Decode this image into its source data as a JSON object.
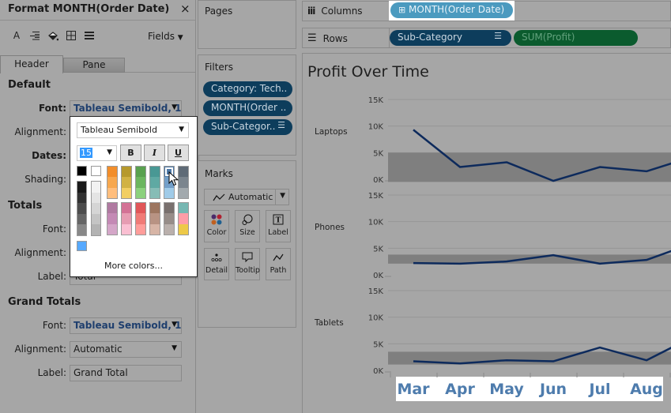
{
  "format_pane": {
    "title": "Format MONTH(Order Date)",
    "close_icon": "×",
    "toolbar_icons": [
      "font-icon",
      "alignment-icon",
      "shading-icon",
      "borders-icon",
      "lines-icon"
    ],
    "fields_label": "Fields",
    "tabs": [
      {
        "label": "Header",
        "active": true
      },
      {
        "label": "Pane",
        "active": false
      }
    ],
    "default_section": {
      "title": "Default",
      "font_label": "Font:",
      "font_value": "Tableau Semibold, 1..",
      "alignment_label": "Alignment:",
      "dates_label": "Dates:",
      "shading_label": "Shading:"
    },
    "totals_section": {
      "title": "Totals",
      "font_label": "Font:",
      "alignment_label": "Alignment:",
      "label_label": "Label:",
      "label_value": "Total"
    },
    "grand_totals_section": {
      "title": "Grand Totals",
      "font_label": "Font:",
      "font_value": "Tableau Semibold, 1..",
      "alignment_label": "Alignment:",
      "alignment_value": "Automatic",
      "label_label": "Label:",
      "label_value": "Grand Total"
    }
  },
  "font_popup": {
    "font_family": "Tableau Semibold",
    "font_size": "15",
    "bold_label": "B",
    "italic_label": "I",
    "underline_label": "U",
    "selected_color": "#4e79a7",
    "black": "#000000",
    "white": "#ffffff",
    "recent_color": "#56a9ff",
    "gray_ramp_dark": [
      "#1a1a1a",
      "#333333",
      "#4d4d4d",
      "#666666",
      "#888888"
    ],
    "gray_ramp_light": [
      "#f2f2f2",
      "#e4e4e4",
      "#d5d5d5",
      "#c4c4c4",
      "#b3b3b3"
    ],
    "palette_row1": [
      [
        "#f28e2b",
        "#f7a84f",
        "#ffbe7d"
      ],
      [
        "#b6992d",
        "#d1b244",
        "#f1ce63"
      ],
      [
        "#59a14f",
        "#6cb65f",
        "#8cd17d"
      ],
      [
        "#499894",
        "#5fa9a3",
        "#86bcb6"
      ],
      [
        "#4e79a7",
        "#739fc9",
        "#a0cbe8"
      ],
      [
        "#5f6b77",
        "#7b858e",
        "#a2a9ad"
      ]
    ],
    "palette_row2": [
      [
        "#b07aa1",
        "#c48ab5",
        "#d4a6c8"
      ],
      [
        "#d37295",
        "#e69cb2",
        "#fabfd2"
      ],
      [
        "#e15759",
        "#f07b77",
        "#ff9d9a"
      ],
      [
        "#9d7660",
        "#b89383",
        "#d7b5a6"
      ],
      [
        "#79706e",
        "#978d89",
        "#bab0ac"
      ],
      [
        "#76b7b2",
        "#ff9da7",
        "#edc948"
      ]
    ],
    "more_colors_label": "More colors..."
  },
  "pages": {
    "title": "Pages"
  },
  "filters": {
    "title": "Filters",
    "items": [
      "Category: Tech..",
      "MONTH(Order ..",
      "Sub-Categor.."
    ]
  },
  "marks": {
    "title": "Marks",
    "mark_type": "Automatic",
    "buttons": [
      "Color",
      "Size",
      "Label",
      "Detail",
      "Tooltip",
      "Path"
    ]
  },
  "columns_shelf": {
    "label": "Columns",
    "pills": [
      "MONTH(Order Date)"
    ]
  },
  "rows_shelf": {
    "label": "Rows",
    "pills": [
      "Sub-Category",
      "SUM(Profit)"
    ]
  },
  "chart_data": {
    "type": "line",
    "title": "Profit Over Time",
    "categories": [
      "Mar",
      "Apr",
      "May",
      "Jun",
      "Jul",
      "Aug"
    ],
    "xlabel": "",
    "ylabel": "",
    "y_ticks": [
      "15K",
      "10K",
      "5K",
      "0K"
    ],
    "ylim": [
      0,
      15000
    ],
    "grid": true,
    "line_color": "#0d2a5c",
    "band_color": "#7f7f7f",
    "series": [
      {
        "name": "Laptops",
        "values": [
          9300,
          2300,
          3200,
          -300,
          2300,
          1500
        ],
        "next_value_partial": 3000,
        "band": [
          -500,
          5000
        ]
      },
      {
        "name": "Phones",
        "values": [
          2200,
          2100,
          2500,
          3700,
          2100,
          2800
        ],
        "next_value_partial": 4500,
        "band": [
          2100,
          3800
        ]
      },
      {
        "name": "Tablets",
        "values": [
          1700,
          1300,
          1900,
          1700,
          4300,
          1900
        ],
        "next_value_partial": 4300,
        "band": [
          1100,
          3500
        ]
      }
    ]
  }
}
